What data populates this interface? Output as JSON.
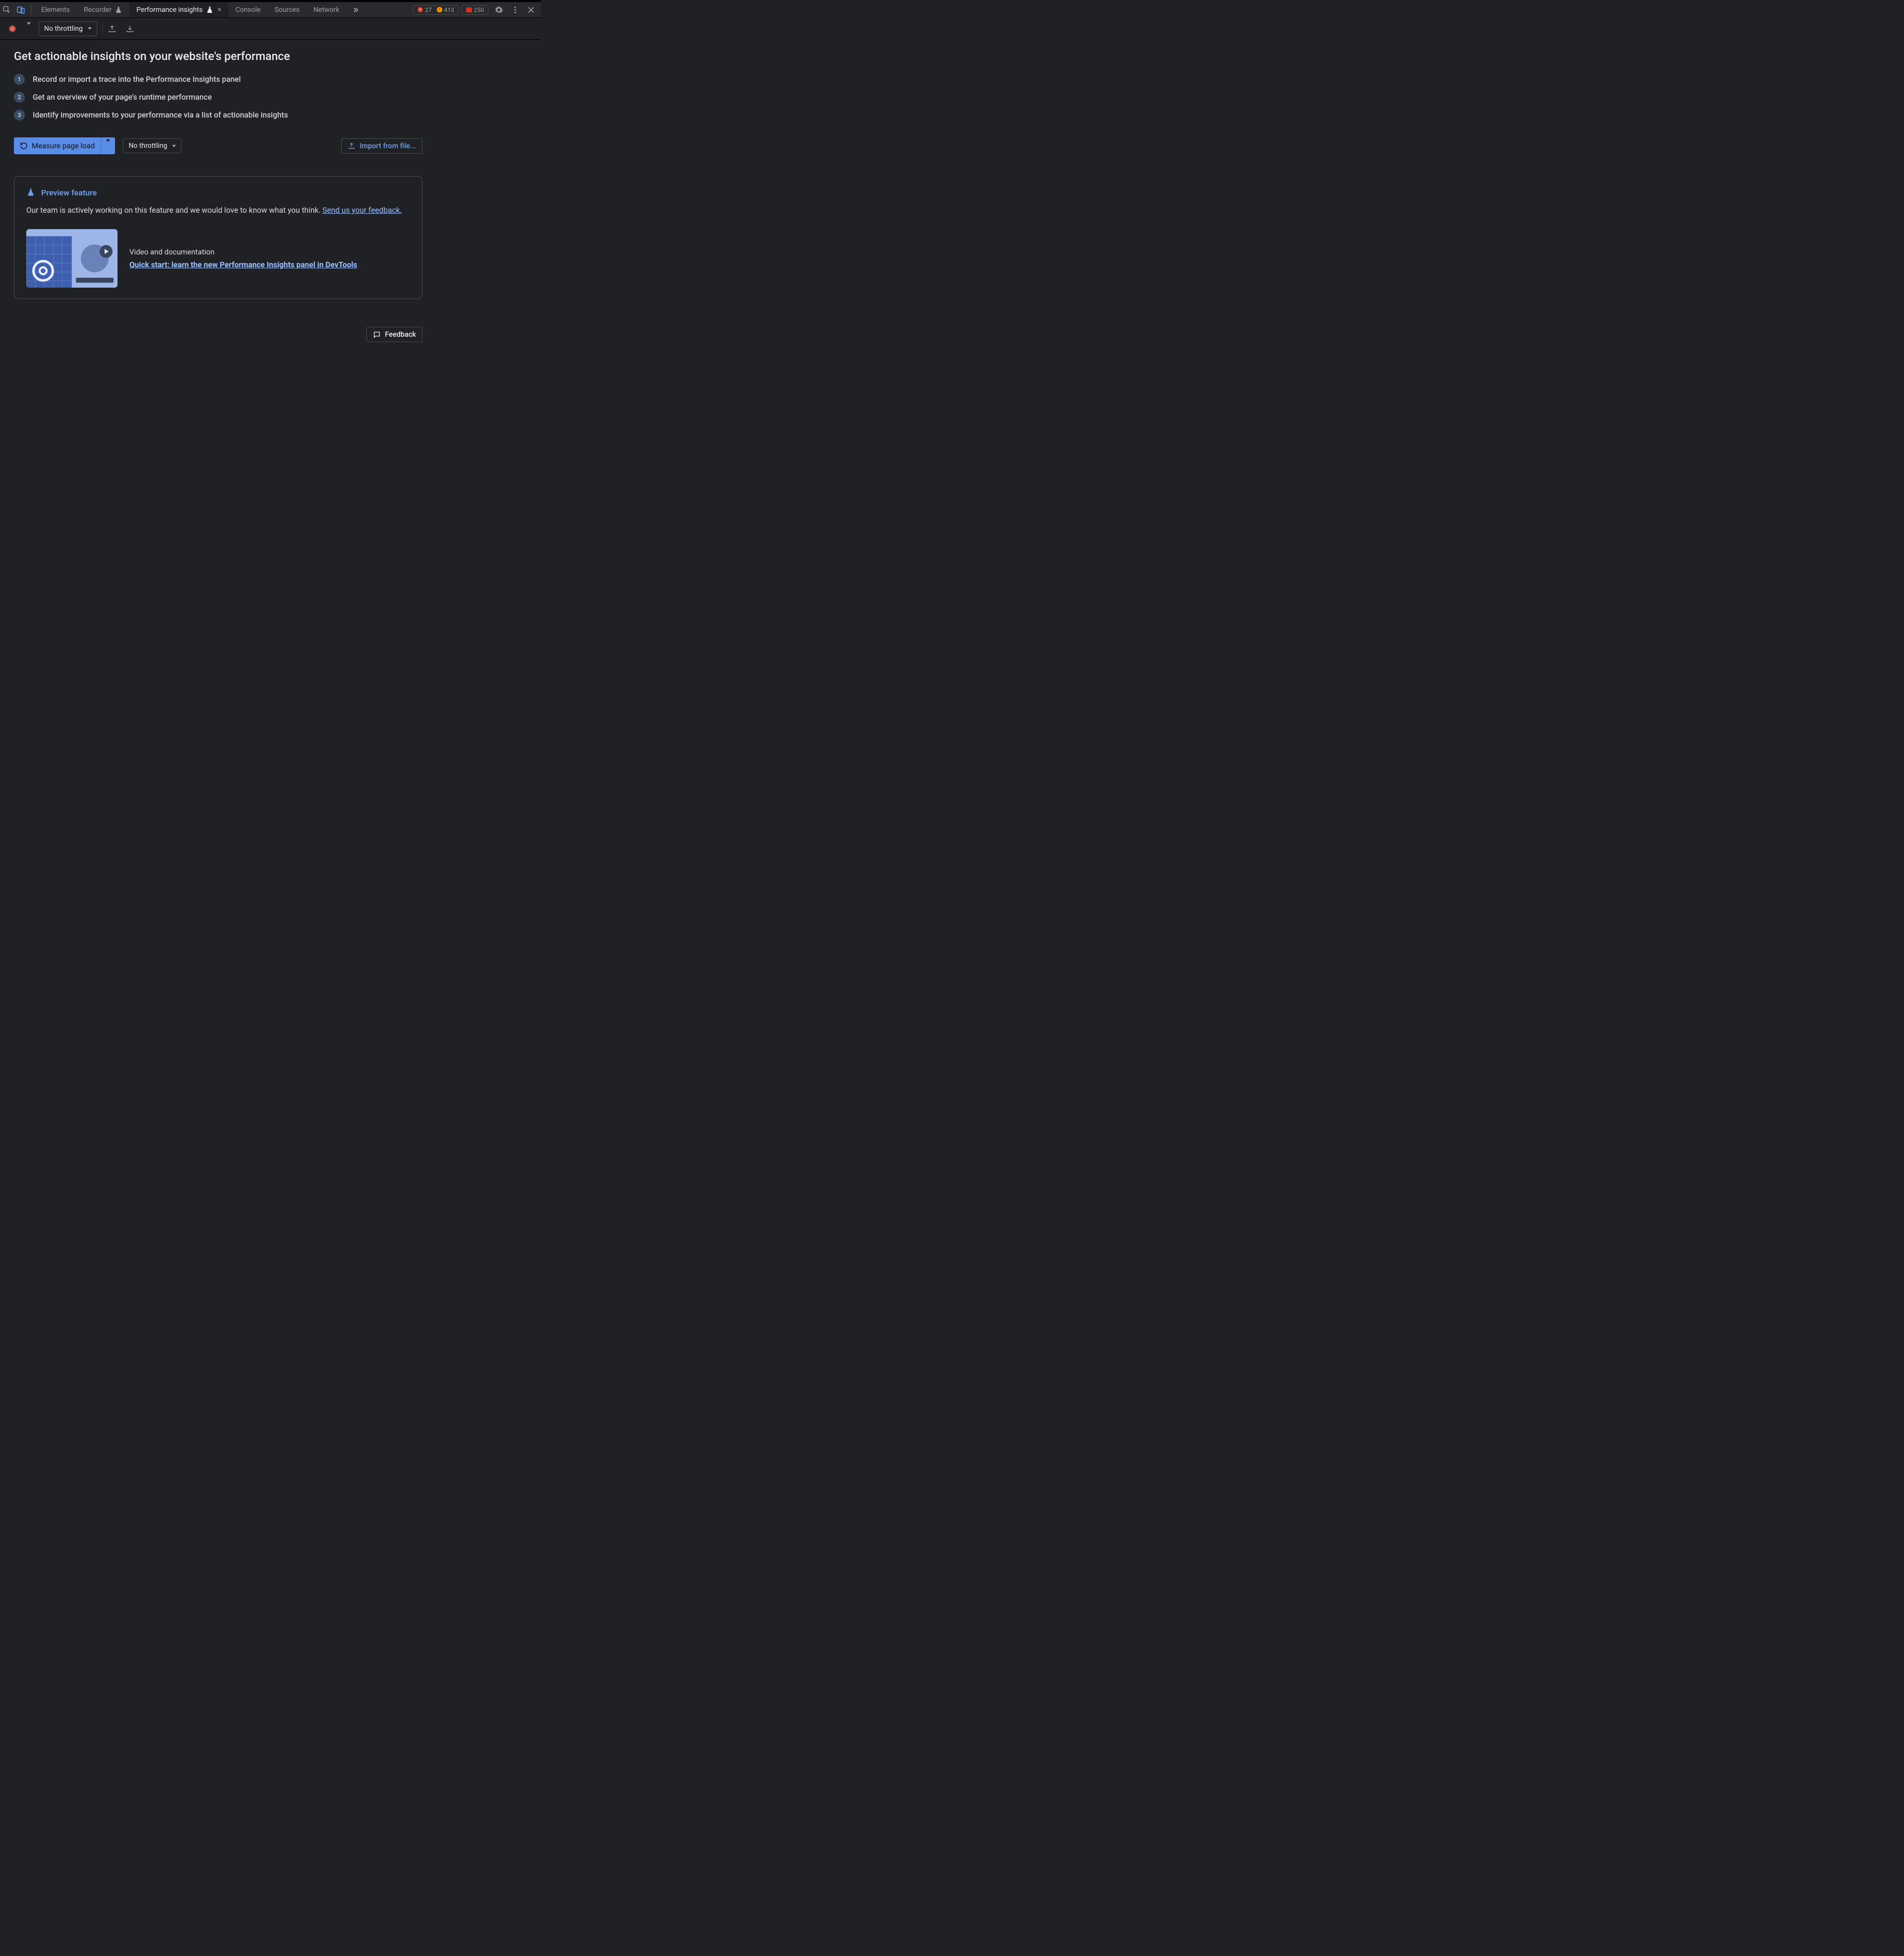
{
  "tabs": {
    "elements": "Elements",
    "recorder": "Recorder",
    "perf_insights": "Performance insights",
    "console": "Console",
    "sources": "Sources",
    "network": "Network"
  },
  "counters": {
    "errors": "27",
    "warnings": "413",
    "issues": "250"
  },
  "toolbar": {
    "throttling": "No throttling"
  },
  "main": {
    "title": "Get actionable insights on your website's performance",
    "steps": [
      "Record or import a trace into the Performance Insights panel",
      "Get an overview of your page's runtime performance",
      "Identify improvements to your performance via a list of actionable insights"
    ],
    "measure_label": "Measure page load",
    "throttle2": "No throttling",
    "import_label": "Import from file..."
  },
  "preview": {
    "title": "Preview feature",
    "desc": "Our team is actively working on this feature and we would love to know what you think. ",
    "feedback_link": "Send us your feedback.",
    "video_title": "Video and documentation",
    "video_link": "Quick start: learn the new Performance Insights panel in DevTools"
  },
  "feedback_btn": "Feedback"
}
